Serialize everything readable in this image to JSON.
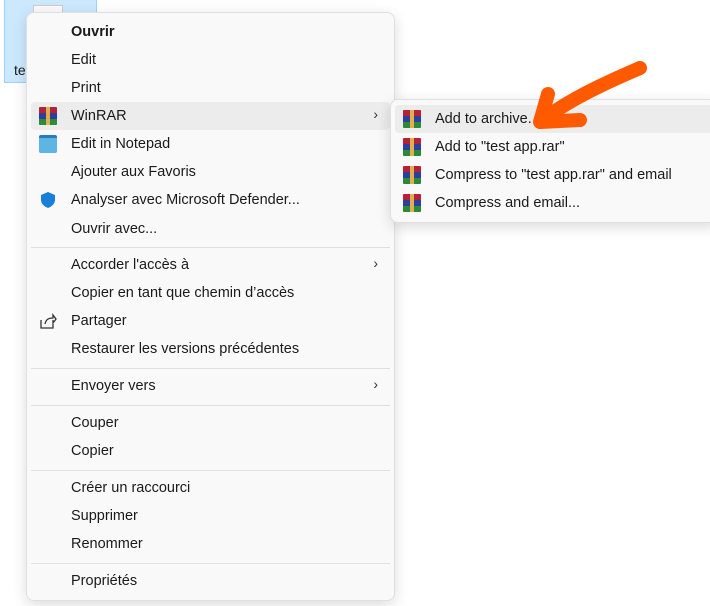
{
  "desktop": {
    "file_label": "te"
  },
  "main_menu": {
    "items": [
      {
        "label": "Ouvrir",
        "bold": true
      },
      {
        "label": "Edit"
      },
      {
        "label": "Print"
      },
      {
        "label": "WinRAR",
        "icon": "winrar-icon",
        "submenu": true
      },
      {
        "label": "Edit in Notepad",
        "icon": "notepad-icon"
      },
      {
        "label": "Ajouter aux Favoris"
      },
      {
        "label": "Analyser avec Microsoft Defender...",
        "icon": "defender-shield-icon"
      },
      {
        "label": "Ouvrir avec..."
      },
      {
        "label": "Accorder l'accès à",
        "submenu": true
      },
      {
        "label": "Copier en tant que chemin d’accès"
      },
      {
        "label": "Partager",
        "icon": "share-icon"
      },
      {
        "label": "Restaurer les versions précédentes"
      },
      {
        "label": "Envoyer vers",
        "submenu": true
      },
      {
        "label": "Couper"
      },
      {
        "label": "Copier"
      },
      {
        "label": "Créer un raccourci"
      },
      {
        "label": "Supprimer"
      },
      {
        "label": "Renommer"
      },
      {
        "label": "Propriétés"
      }
    ]
  },
  "winrar_submenu": {
    "items": [
      {
        "label": "Add to archive..."
      },
      {
        "label": "Add to \"test app.rar\""
      },
      {
        "label": "Compress to \"test app.rar\" and email"
      },
      {
        "label": "Compress and email..."
      }
    ]
  },
  "annotation": {
    "arrow_color": "#ff5a00"
  }
}
